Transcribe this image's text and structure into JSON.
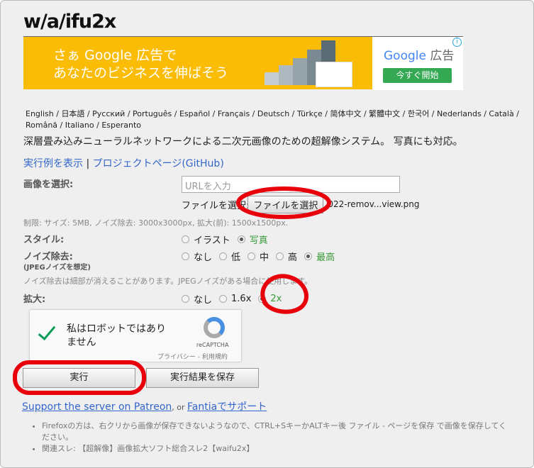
{
  "title": "w/a/ifu2x",
  "ad": {
    "line1": "さぁ Google 広告で",
    "line2": "あなたのビジネスを伸ばそう",
    "brand": "Google",
    "brand_suffix": "広告",
    "cta": "今すぐ開始",
    "info": "i",
    "colors": {
      "bg": "#fbbc05",
      "cta": "#34a853"
    }
  },
  "languages": [
    "English",
    "日本語",
    "Русский",
    "Português",
    "Español",
    "Français",
    "Deutsch",
    "Türkçe",
    "简体中文",
    "繁體中文",
    "한국어",
    "Nederlands",
    "Català",
    "Română",
    "Italiano",
    "Esperanto"
  ],
  "description": "深層畳み込みニューラルネットワークによる二次元画像のための超解像システム。 写真にも対応。",
  "links": {
    "examples": "実行例を表示",
    "sep": "|",
    "project": "プロジェクトページ(GitHub)"
  },
  "form": {
    "image_label": "画像を選択:",
    "url_placeholder": "URLを入力",
    "file_label": "ファイルを選択:",
    "file_button": "ファイルを選択",
    "file_name": "022-remov...view.png",
    "limits": "制限: サイズ: 5MB, ノイズ除去: 3000x3000px, 拡大(前): 1500x1500px.",
    "style_label": "スタイル:",
    "style_options": [
      {
        "label": "イラスト",
        "selected": false
      },
      {
        "label": "写真",
        "selected": true
      }
    ],
    "noise_label": "ノイズ除去:",
    "noise_sub": "(JPEGノイズを想定)",
    "noise_options": [
      {
        "label": "なし",
        "selected": false
      },
      {
        "label": "低",
        "selected": false
      },
      {
        "label": "中",
        "selected": false
      },
      {
        "label": "高",
        "selected": false
      },
      {
        "label": "最高",
        "selected": true
      }
    ],
    "noise_note": "ノイズ除去は細部が消えることがあります。JPEGノイズがある場合に使用します。",
    "scale_label": "拡大:",
    "scale_options": [
      {
        "label": "なし",
        "selected": false
      },
      {
        "label": "1.6x",
        "selected": false
      },
      {
        "label": "2x",
        "selected": true
      }
    ]
  },
  "captcha": {
    "text1": "私はロボットではあり",
    "text2": "ません",
    "brand": "reCAPTCHA",
    "privacy": "プライバシー",
    "sep": "-",
    "terms": "利用規約",
    "checked": true
  },
  "buttons": {
    "run": "実行",
    "save": "実行結果を保存"
  },
  "support": {
    "patreon": "Support the server on Patreon",
    "sep": ", or ",
    "fantia": "Fantiaでサポート"
  },
  "notes": [
    "Firefoxの方は、右クリから画像が保存できないようなので、CTRL+SキーかALTキー後 ファイル - ページを保存 で画像を保存してください。",
    "関連スレ: 【超解像】画像拡大ソフト総合スレ2【waifu2x】"
  ],
  "annotation_color": "#e8000b"
}
